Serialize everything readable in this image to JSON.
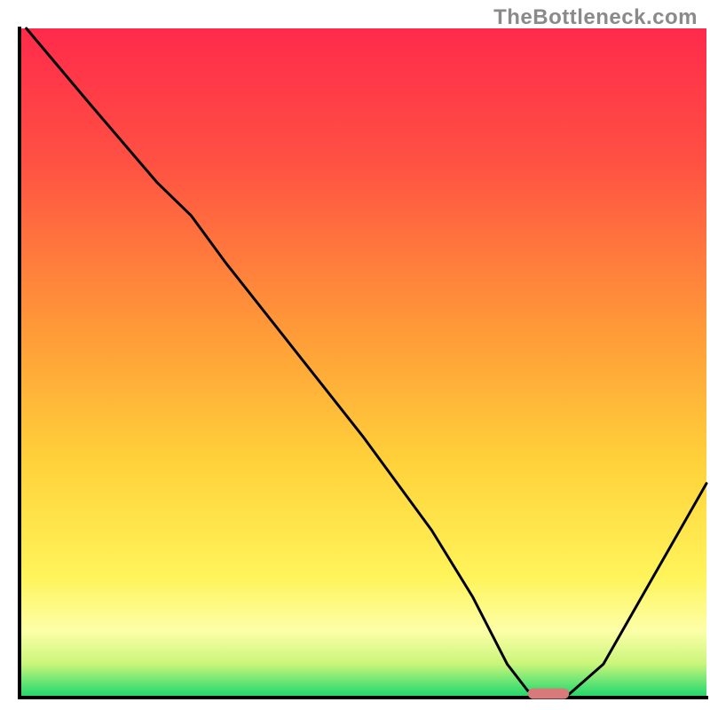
{
  "watermark": "TheBottleneck.com",
  "chart_data": {
    "type": "line",
    "title": "",
    "xlabel": "",
    "ylabel": "",
    "xlim": [
      0,
      100
    ],
    "ylim": [
      0,
      100
    ],
    "grid": false,
    "legend": false,
    "annotations": [],
    "series": [
      {
        "name": "curve",
        "x": [
          1,
          10,
          20,
          25,
          30,
          40,
          50,
          60,
          66,
          71,
          74,
          77,
          80,
          85,
          90,
          95,
          100
        ],
        "y": [
          100,
          89,
          77,
          72,
          65,
          52,
          39,
          25,
          15,
          5,
          1,
          0.5,
          0.5,
          5,
          14,
          23,
          32
        ]
      }
    ],
    "highlight_segment": {
      "x_start": 74,
      "x_end": 80,
      "y": 0.6
    },
    "background_gradient": {
      "description": "Vertical gradient from red (top) through orange, yellow, pale yellow, to green (bottom)",
      "stops": [
        {
          "offset": 0.0,
          "color": "#ff2a4b"
        },
        {
          "offset": 0.2,
          "color": "#ff5143"
        },
        {
          "offset": 0.45,
          "color": "#ff9a38"
        },
        {
          "offset": 0.65,
          "color": "#ffd23a"
        },
        {
          "offset": 0.82,
          "color": "#fff45a"
        },
        {
          "offset": 0.9,
          "color": "#fdffa8"
        },
        {
          "offset": 0.95,
          "color": "#c9f57a"
        },
        {
          "offset": 0.985,
          "color": "#4be072"
        },
        {
          "offset": 1.0,
          "color": "#1fd36b"
        }
      ]
    },
    "axis_color": "#000000",
    "line_color": "#000000",
    "highlight_color": "#d97a7a"
  }
}
